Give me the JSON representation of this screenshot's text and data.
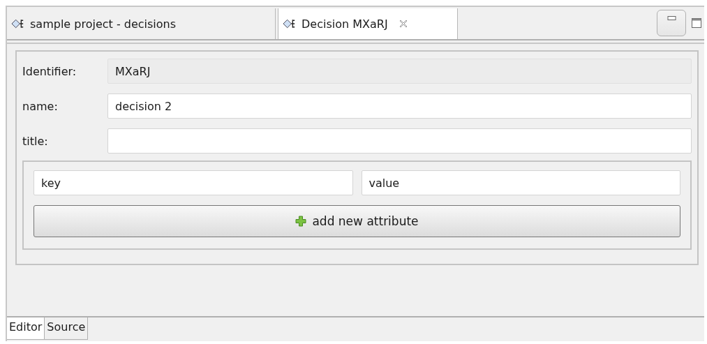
{
  "editor_tabs": [
    {
      "label": "sample project - decisions",
      "selected": false,
      "closable": false
    },
    {
      "label": "Decision MXaRJ",
      "selected": true,
      "closable": true
    }
  ],
  "fields": [
    {
      "label": "Identifier:",
      "value": "MXaRJ",
      "readonly": true
    },
    {
      "label": "name:",
      "value": "decision 2",
      "readonly": false
    },
    {
      "label": "title:",
      "readonly": false
    }
  ],
  "attribute": {
    "key": "key",
    "value": "value",
    "add_button": "add new attribute"
  },
  "bottom_tabs": [
    {
      "label": "Editor",
      "selected": true
    },
    {
      "label": "Source",
      "selected": false
    }
  ]
}
